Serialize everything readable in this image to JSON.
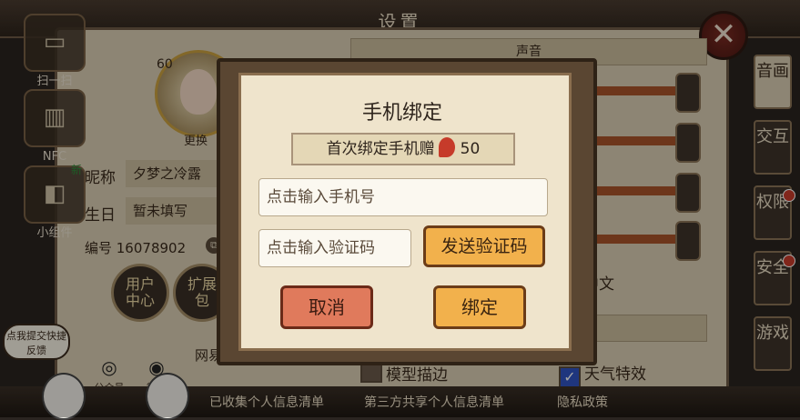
{
  "header": {
    "title": "设置"
  },
  "left_tools": [
    {
      "label": "扫一扫",
      "icon": "scan-icon"
    },
    {
      "label": "NFC",
      "icon": "nfc-icon"
    },
    {
      "label": "小组件",
      "icon": "widget-icon"
    }
  ],
  "right_tabs": [
    {
      "label": "音画"
    },
    {
      "label": "交互"
    },
    {
      "label": "权限"
    },
    {
      "label": "安全"
    },
    {
      "label": "游戏"
    }
  ],
  "profile": {
    "level": "60",
    "change_label": "更换",
    "nickname_label": "昵称",
    "nickname_value": "夕梦之冷露",
    "new_badge": "新",
    "birthday_label": "生日",
    "birthday_value": "暂未填写",
    "id_text": "编号 16078902",
    "user_center_label": "用户中心",
    "extension_label": "扩展包"
  },
  "social": [
    {
      "label": "公众号",
      "icon": "wechat-icon"
    },
    {
      "label": "微博",
      "icon": "weibo-icon"
    }
  ],
  "partial_text": "网易",
  "sound_section": {
    "label": "声音"
  },
  "language": "中文",
  "checkboxes": [
    {
      "label": "模型描边",
      "checked": false
    },
    {
      "label": "天气特效",
      "checked": true
    }
  ],
  "bottom_links": [
    "已收集个人信息清单",
    "第三方共享个人信息清单",
    "隐私政策"
  ],
  "feedback": {
    "text": "点我提交快捷反馈"
  },
  "modal": {
    "title": "手机绑定",
    "bonus_text": "首次绑定手机赠",
    "bonus_amount": "50",
    "phone_placeholder": "点击输入手机号",
    "code_placeholder": "点击输入验证码",
    "send_code_label": "发送验证码",
    "cancel_label": "取消",
    "bind_label": "绑定"
  },
  "colors": {
    "accent_orange": "#f2b14c",
    "cancel_red": "#e07a5c",
    "checkbox_blue": "#3153c2"
  }
}
